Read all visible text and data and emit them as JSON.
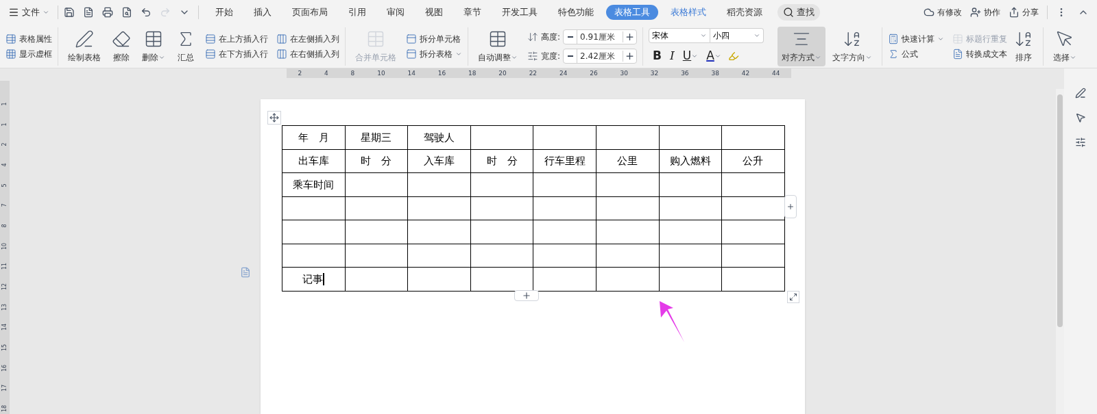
{
  "menu_bar": {
    "file": "文件",
    "tabs": [
      {
        "label": "开始",
        "selected": false
      },
      {
        "label": "插入",
        "selected": false
      },
      {
        "label": "页面布局",
        "selected": false
      },
      {
        "label": "引用",
        "selected": false
      },
      {
        "label": "审阅",
        "selected": false
      },
      {
        "label": "视图",
        "selected": false
      },
      {
        "label": "章节",
        "selected": false
      },
      {
        "label": "开发工具",
        "selected": false
      },
      {
        "label": "特色功能",
        "selected": false
      },
      {
        "label": "表格工具",
        "selected": true
      },
      {
        "label": "表格样式",
        "selected": false
      },
      {
        "label": "稻壳资源",
        "selected": false
      }
    ],
    "search": "查找",
    "actions": [
      "有修改",
      "协作",
      "分享"
    ]
  },
  "ribbon": {
    "table_options": [
      "表格属性",
      "显示虚框"
    ],
    "draw_tools": [
      {
        "label": "绘制表格",
        "dropdown": false
      },
      {
        "label": "擦除",
        "dropdown": false
      },
      {
        "label": "删除",
        "dropdown": true
      },
      {
        "label": "汇总",
        "dropdown": false
      }
    ],
    "insert_rows": [
      "在上方插入行",
      "在下方插入行"
    ],
    "insert_columns": [
      "在左侧插入列",
      "在右侧插入列"
    ],
    "merge": {
      "label": "合并单元格",
      "disabled": true
    },
    "split": [
      "拆分单元格",
      "拆分表格"
    ],
    "auto_fit": "自动调整",
    "height": {
      "label": "高度:",
      "value": "0.91厘米"
    },
    "width": {
      "label": "宽度:",
      "value": "2.42厘米"
    },
    "font": {
      "name": "宋体",
      "size": "小四"
    },
    "format_buttons": [
      {
        "label": "B",
        "kind": "bold"
      },
      {
        "label": "I",
        "kind": "italic"
      },
      {
        "label": "U",
        "kind": "underline"
      },
      {
        "label": "A",
        "kind": "color"
      }
    ],
    "alignment": {
      "label": "对齐方式",
      "selected": true
    },
    "text_direction": "文字方向",
    "quick_calc": "快速计算",
    "formula": "公式",
    "repeat_header": {
      "label": "标题行重复",
      "disabled": true
    },
    "to_text": "转换成文本",
    "sort": "排序",
    "select": "选择"
  },
  "ruler": [
    "2",
    "4",
    "8",
    "10",
    "14",
    "16",
    "18",
    "20",
    "22",
    "24",
    "26",
    "30",
    "32",
    "36",
    "38",
    "42",
    "44"
  ],
  "vertical_ruler": [
    "1",
    "1",
    "2",
    "4",
    "5",
    "7",
    "8",
    "10",
    "11",
    "12",
    "13",
    "14",
    "15",
    "16",
    "17",
    "18"
  ],
  "table": {
    "rows": [
      {
        "cells": [
          "年　月",
          "星期三",
          "驾驶人",
          "",
          "",
          "",
          "",
          ""
        ],
        "caret": false
      },
      {
        "cells": [
          "出车库",
          "时　分",
          "入车库",
          "时　分",
          "行车里程",
          "公里",
          "购入燃料",
          "公升"
        ],
        "caret": false
      },
      {
        "cells": [
          "乘车时间",
          "",
          "",
          "",
          "",
          "",
          "",
          ""
        ],
        "caret": false
      },
      {
        "cells": [
          "",
          "",
          "",
          "",
          "",
          "",
          "",
          ""
        ],
        "caret": false
      },
      {
        "cells": [
          "",
          "",
          "",
          "",
          "",
          "",
          "",
          ""
        ],
        "caret": false
      },
      {
        "cells": [
          "",
          "",
          "",
          "",
          "",
          "",
          "",
          ""
        ],
        "caret": false
      },
      {
        "cells": [
          "记事",
          "",
          "",
          "",
          "",
          "",
          "",
          ""
        ],
        "caret": true
      }
    ]
  }
}
